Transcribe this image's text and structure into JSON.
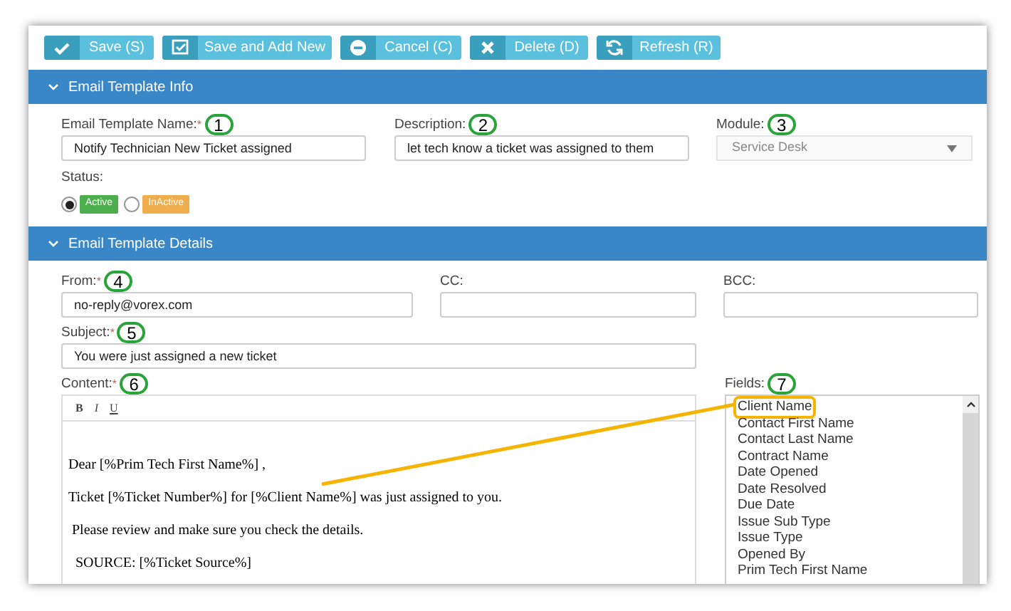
{
  "toolbar": [
    {
      "kind": "save",
      "label": "Save (S)"
    },
    {
      "kind": "save-new",
      "label": "Save and Add New"
    },
    {
      "kind": "cancel",
      "label": "Cancel (C)"
    },
    {
      "kind": "delete",
      "label": "Delete (D)"
    },
    {
      "kind": "refresh",
      "label": "Refresh (R)"
    }
  ],
  "info_section": {
    "title": "Email Template Info",
    "expanded": true,
    "name": {
      "label": "Email Template Name:",
      "required_mark": "*",
      "annotation": "1",
      "value": "Notify Technician New Ticket assigned"
    },
    "description": {
      "label": "Description:",
      "annotation": "2",
      "value": "let tech know a ticket was assigned to them"
    },
    "module": {
      "label": "Module:",
      "annotation": "3",
      "value": "Service Desk",
      "disabled": true
    },
    "status": {
      "label": "Status:",
      "options": [
        {
          "label": "Active",
          "selected": true,
          "color": "#4cae4c"
        },
        {
          "label": "InActive",
          "selected": false,
          "color": "#f0ad4e"
        }
      ]
    }
  },
  "details_section": {
    "title": "Email Template Details",
    "expanded": true,
    "from": {
      "label": "From:",
      "required_mark": "*",
      "annotation": "4",
      "value": "no-reply@vorex.com"
    },
    "cc": {
      "label": "CC:"
    },
    "bcc": {
      "label": "BCC:"
    },
    "subject": {
      "label": "Subject:",
      "required_mark": "*",
      "annotation": "5",
      "value": "You were just assigned a new ticket"
    },
    "content": {
      "label": "Content:",
      "required_mark": "*",
      "annotation": "6",
      "format_buttons": [
        "B",
        "I",
        "U"
      ],
      "paragraphs": [
        "Dear [%Prim Tech First Name%] ,",
        "Ticket [%Ticket Number%] for [%Client Name%] was just assigned to you.",
        " Please review and make sure you check the details.",
        "  SOURCE: [%Ticket Source%]"
      ]
    },
    "fields": {
      "label": "Fields:",
      "annotation": "7",
      "items": [
        {
          "label": "Client Name",
          "highlighted": true
        },
        {
          "label": "Contact First Name",
          "highlighted": false
        },
        {
          "label": "Contact Last Name",
          "highlighted": false
        },
        {
          "label": "Contract Name",
          "highlighted": false
        },
        {
          "label": "Date Opened",
          "highlighted": false
        },
        {
          "label": "Date Resolved",
          "highlighted": false
        },
        {
          "label": "Due Date",
          "highlighted": false
        },
        {
          "label": "Issue Sub Type",
          "highlighted": false
        },
        {
          "label": "Issue Type",
          "highlighted": false
        },
        {
          "label": "Opened By",
          "highlighted": false
        },
        {
          "label": "Prim Tech First Name",
          "highlighted": false
        }
      ]
    }
  }
}
